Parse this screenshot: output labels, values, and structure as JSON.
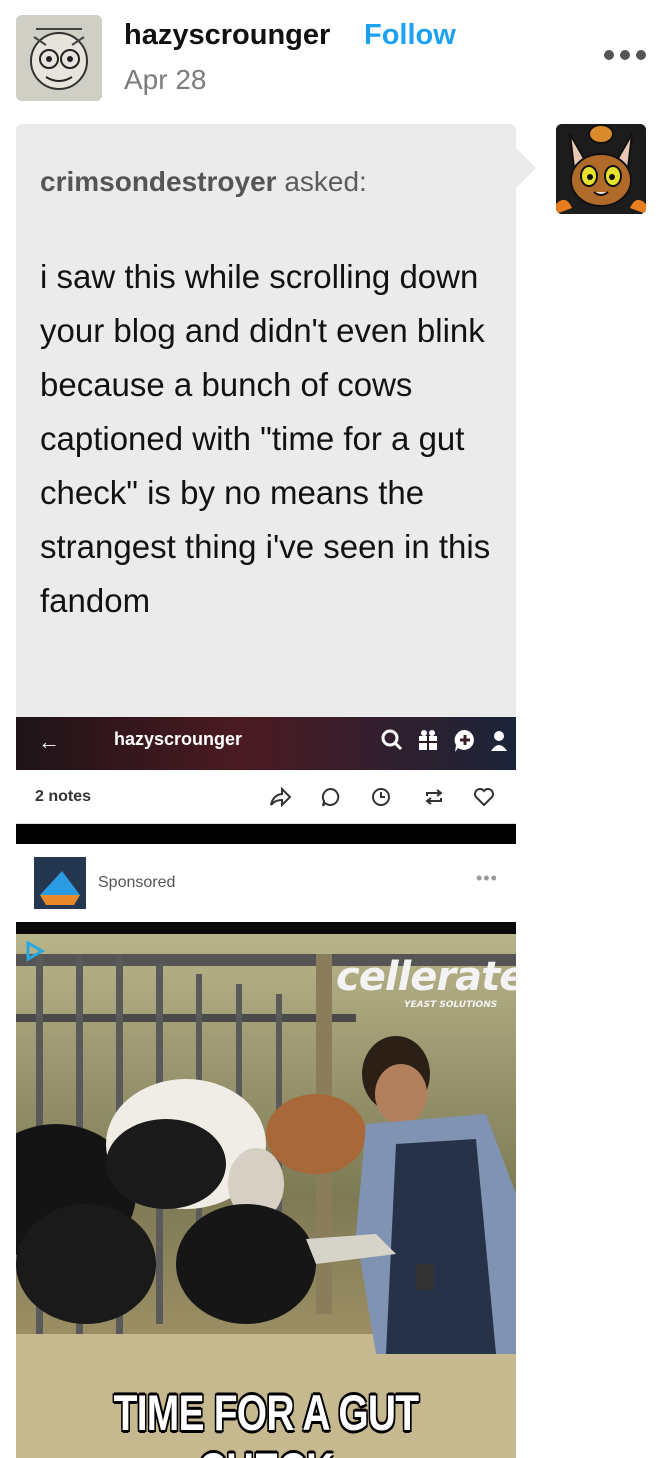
{
  "post": {
    "blog_name": "hazyscrounger",
    "follow_label": "Follow",
    "date": "Apr 28"
  },
  "ask": {
    "asker": "crimsondestroyer",
    "asked_label": "asked:",
    "question": "i saw this while scrolling down your blog and didn't even blink because a bunch of cows captioned with \"time for a gut check\" is by no means the strangest thing i've seen in this fandom"
  },
  "embedded_screenshot": {
    "blog_name": "hazyscrounger",
    "notes": "2 notes",
    "sponsored_label": "Sponsored",
    "ad_brand": "cellerate",
    "ad_brand_sub": "YEAST SOLUTIONS",
    "ad_caption": "TIME FOR A GUT CHECK"
  },
  "colors": {
    "follow": "#1da1f2",
    "bubble": "#ebebeb"
  },
  "icons": [
    "more-icon",
    "back-arrow-icon",
    "search-icon",
    "gift-icon",
    "plus-bubble-icon",
    "account-icon",
    "share-icon",
    "reply-icon",
    "clock-icon",
    "reblog-icon",
    "heart-icon",
    "play-icon"
  ]
}
